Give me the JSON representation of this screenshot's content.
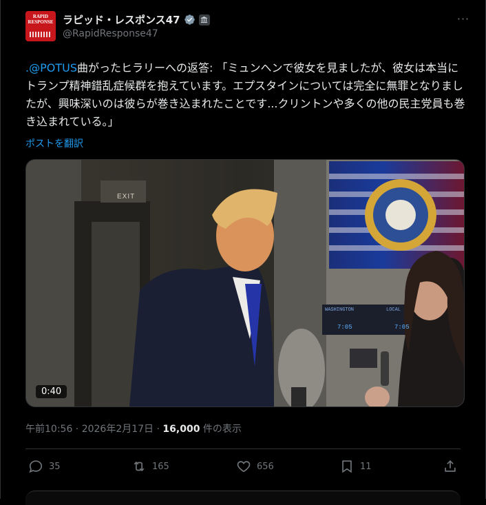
{
  "author": {
    "name": "ラピッド・レスポンス47",
    "handle": "@RapidResponse47",
    "avatar_text": "RAPID RESPONSE"
  },
  "post": {
    "mention": ".@POTUS",
    "text": "曲がったヒラリーへの返答: 「ミュンヘンで彼女を見ましたが、彼女は本当にトランプ精神錯乱症候群を抱えています。エプスタインについては完全に無罪となりましたが、興味深いのは彼らが巻き込まれたことです...クリントンや多くの他の民主党員も巻き込まれている。」",
    "translate_label": "ポストを翻訳"
  },
  "video": {
    "duration": "0:40",
    "exit_sign": "EXIT",
    "clock_label_left": "WASHINGTON",
    "clock_label_right": "LOCAL",
    "clock_time_left": "7:05",
    "clock_time_right": "7:05"
  },
  "meta": {
    "time": "午前10:56 · 2026年2月17日 · ",
    "views_count": "16,000",
    "views_label": " 件の表示"
  },
  "actions": {
    "replies": "35",
    "reposts": "165",
    "likes": "656",
    "bookmarks": "11"
  },
  "colors": {
    "accent": "#1d9bf0",
    "muted": "#71767b",
    "background": "#000000"
  }
}
